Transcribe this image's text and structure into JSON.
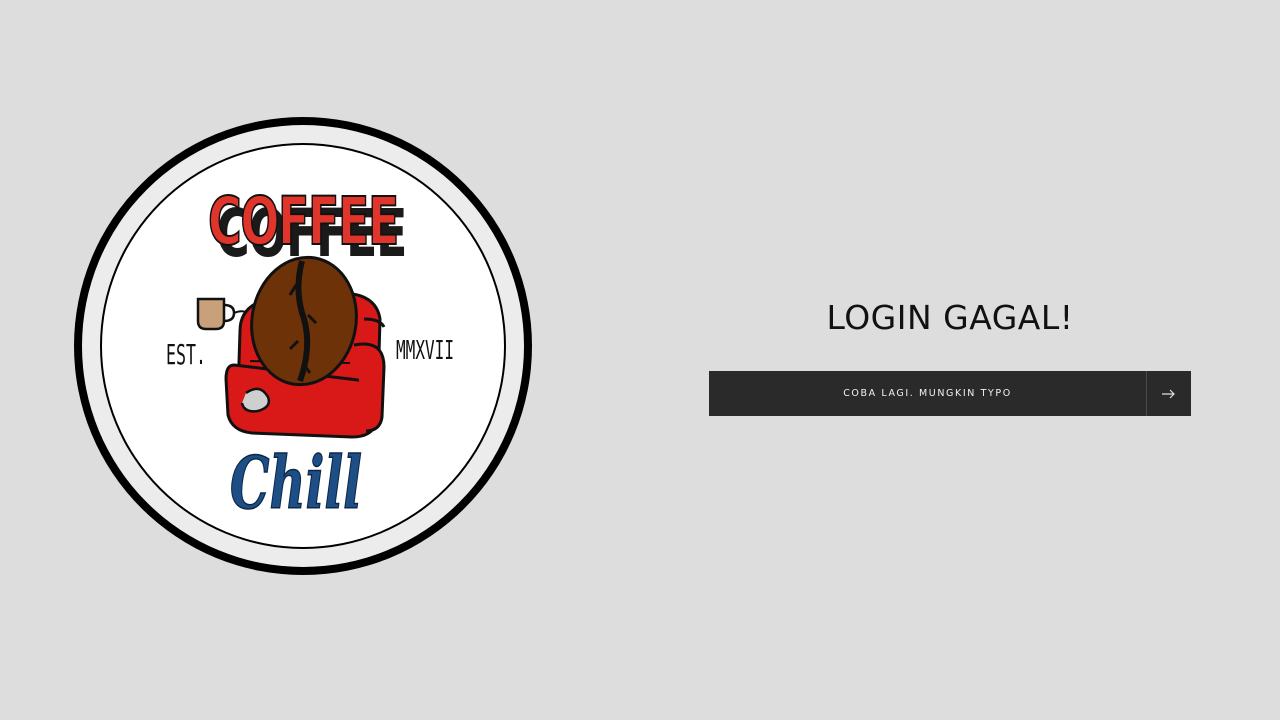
{
  "logo": {
    "top_text": "COFFEE",
    "bottom_text": "Chill",
    "left_text": "EST.",
    "right_text": "MMXVII",
    "colors": {
      "top_text": "#e0352b",
      "bottom_text": "#1d4f86",
      "bean": "#6e3208",
      "chair": "#d91818",
      "mug": "#c8a079"
    }
  },
  "message": {
    "title": "LOGIN GAGAL!"
  },
  "retry_button": {
    "label": "COBA LAGI. MUNGKIN TYPO",
    "icon": "arrow-right-icon"
  },
  "colors": {
    "background": "#dddddd",
    "button": "#2a2a2a",
    "button_text": "#f2f2f2"
  }
}
